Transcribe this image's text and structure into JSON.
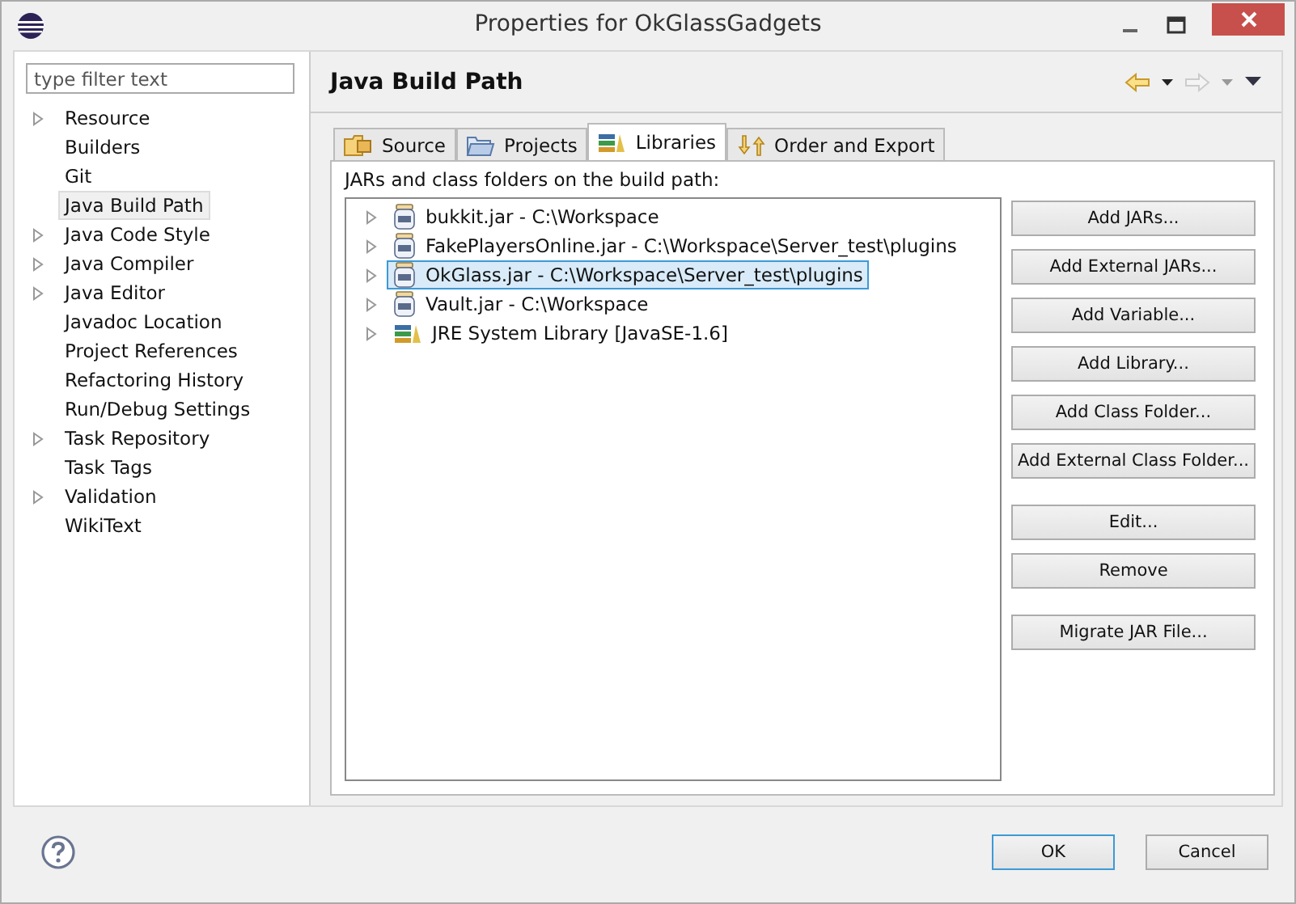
{
  "window": {
    "title": "Properties for OkGlassGadgets"
  },
  "filter": {
    "placeholder": "type filter text"
  },
  "sidebar": {
    "items": [
      {
        "label": "Resource",
        "expandable": true,
        "selected": false
      },
      {
        "label": "Builders",
        "expandable": false,
        "selected": false
      },
      {
        "label": "Git",
        "expandable": false,
        "selected": false
      },
      {
        "label": "Java Build Path",
        "expandable": false,
        "selected": true
      },
      {
        "label": "Java Code Style",
        "expandable": true,
        "selected": false
      },
      {
        "label": "Java Compiler",
        "expandable": true,
        "selected": false
      },
      {
        "label": "Java Editor",
        "expandable": true,
        "selected": false
      },
      {
        "label": "Javadoc Location",
        "expandable": false,
        "selected": false
      },
      {
        "label": "Project References",
        "expandable": false,
        "selected": false
      },
      {
        "label": "Refactoring History",
        "expandable": false,
        "selected": false
      },
      {
        "label": "Run/Debug Settings",
        "expandable": false,
        "selected": false
      },
      {
        "label": "Task Repository",
        "expandable": true,
        "selected": false
      },
      {
        "label": "Task Tags",
        "expandable": false,
        "selected": false
      },
      {
        "label": "Validation",
        "expandable": true,
        "selected": false
      },
      {
        "label": "WikiText",
        "expandable": false,
        "selected": false
      }
    ]
  },
  "page": {
    "title": "Java Build Path"
  },
  "tabs": [
    {
      "label": "Source",
      "kind": "source",
      "selected": false
    },
    {
      "label": "Projects",
      "kind": "projects",
      "selected": false
    },
    {
      "label": "Libraries",
      "kind": "libraries",
      "selected": true
    },
    {
      "label": "Order and Export",
      "kind": "order",
      "selected": false
    }
  ],
  "libraries": {
    "caption": "JARs and class folders on the build path:",
    "items": [
      {
        "label": "bukkit.jar - C:\\Workspace",
        "kind": "jar",
        "selected": false
      },
      {
        "label": "FakePlayersOnline.jar - C:\\Workspace\\Server_test\\plugins",
        "kind": "jar",
        "selected": false
      },
      {
        "label": "OkGlass.jar - C:\\Workspace\\Server_test\\plugins",
        "kind": "jar",
        "selected": true
      },
      {
        "label": "Vault.jar - C:\\Workspace",
        "kind": "jar",
        "selected": false
      },
      {
        "label": "JRE System Library [JavaSE-1.6]",
        "kind": "library",
        "selected": false
      }
    ]
  },
  "button_groups": [
    [
      "Add JARs...",
      "Add External JARs...",
      "Add Variable...",
      "Add Library...",
      "Add Class Folder...",
      "Add External Class Folder..."
    ],
    [
      "Edit...",
      "Remove"
    ],
    [
      "Migrate JAR File..."
    ]
  ],
  "dialog_buttons": [
    {
      "label": "OK",
      "default": true
    },
    {
      "label": "Cancel",
      "default": false
    }
  ]
}
